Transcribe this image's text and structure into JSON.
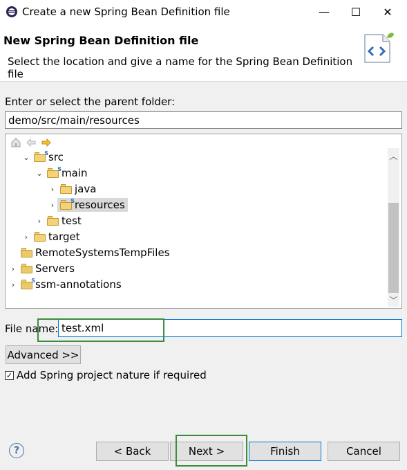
{
  "window": {
    "title": "Create a new Spring Bean Definition file",
    "minimize_glyph": "—",
    "maximize_glyph": "☐",
    "close_glyph": "✕"
  },
  "banner": {
    "title": "New Spring Bean Definition file",
    "description": "Select the location and give a name for the Spring Bean Definition file",
    "icon": "xml-file-code-icon"
  },
  "parent_folder": {
    "label": "Enter or select the parent folder:",
    "value": "demo/src/main/resources"
  },
  "tree": {
    "toolbar": [
      "home-icon",
      "back-arrow-icon",
      "forward-arrow-icon"
    ],
    "items": [
      {
        "label": "src",
        "depth": 1,
        "expanded": true,
        "twisty": "⌄"
      },
      {
        "label": "main",
        "depth": 2,
        "expanded": true,
        "twisty": "⌄"
      },
      {
        "label": "java",
        "depth": 3,
        "expanded": false,
        "twisty": "›"
      },
      {
        "label": "resources",
        "depth": 3,
        "expanded": false,
        "twisty": "›",
        "selected": true
      },
      {
        "label": "test",
        "depth": 2,
        "expanded": false,
        "twisty": "›"
      },
      {
        "label": "target",
        "depth": 1,
        "expanded": false,
        "twisty": "›"
      },
      {
        "label": "RemoteSystemsTempFiles",
        "depth": 0,
        "expanded": false,
        "twisty": ""
      },
      {
        "label": "Servers",
        "depth": 0,
        "expanded": false,
        "twisty": "›"
      },
      {
        "label": "ssm-annotations",
        "depth": 0,
        "expanded": false,
        "twisty": "›"
      }
    ]
  },
  "file_name": {
    "label": "File name:",
    "value": "test.xml"
  },
  "advanced_button": "Advanced >>",
  "spring_nature": {
    "label": "Add Spring project nature if required",
    "checked": true
  },
  "buttons": {
    "help": "?",
    "back": "< Back",
    "next": "Next >",
    "finish": "Finish",
    "cancel": "Cancel"
  },
  "colors": {
    "highlight_box": "#3c8c3c",
    "focus_border": "#0078d7",
    "folder": "#f3d27a"
  }
}
